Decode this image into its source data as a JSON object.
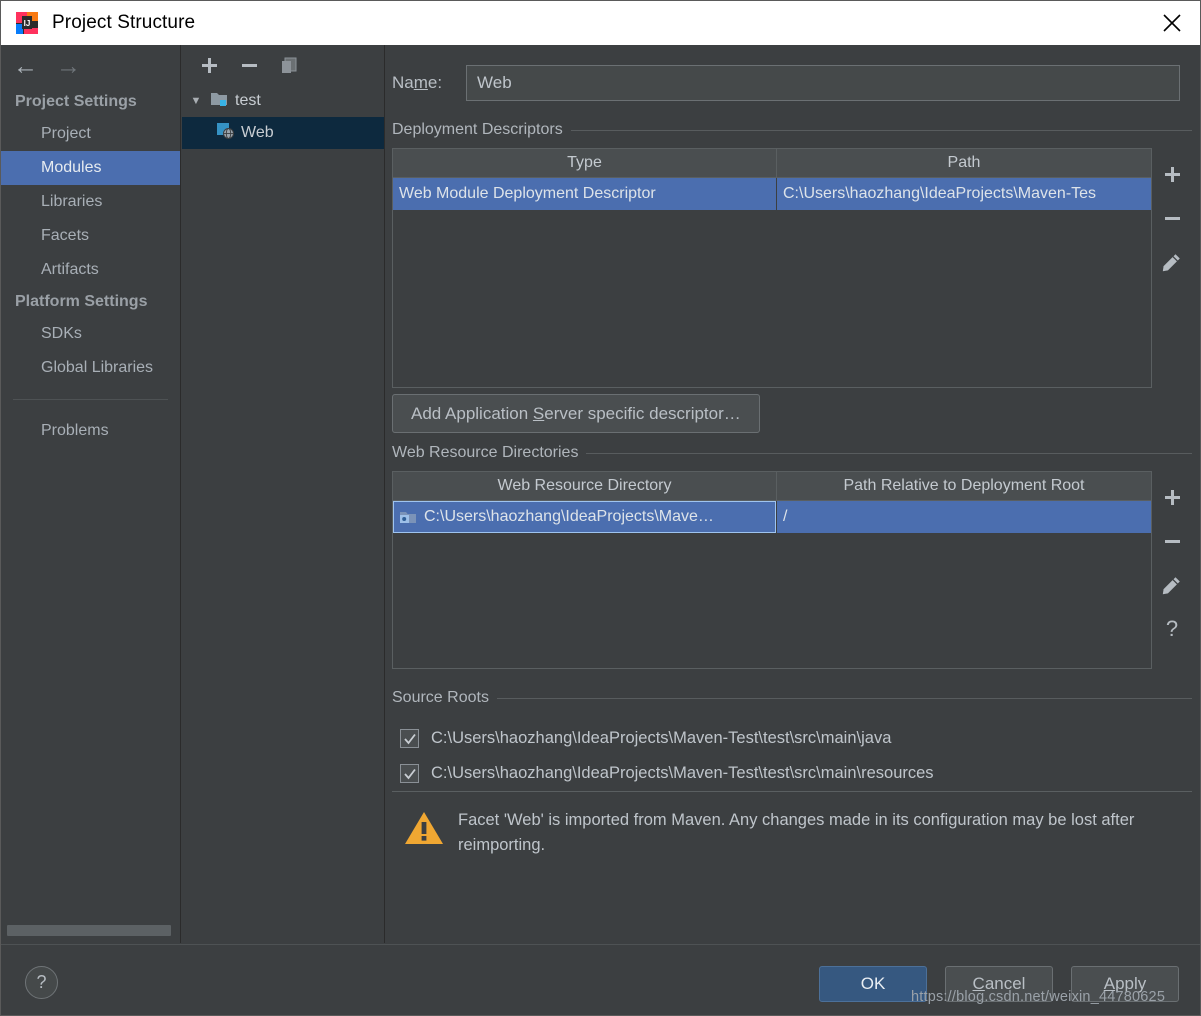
{
  "window": {
    "title": "Project Structure",
    "logo_icon": "intellij-idea-logo-icon",
    "close_icon": "close-icon"
  },
  "sidebar": {
    "back_icon": "arrow-left-icon",
    "forward_icon": "arrow-right-icon",
    "groups": [
      {
        "title": "Project Settings",
        "items": [
          {
            "label": "Project",
            "selected": false
          },
          {
            "label": "Modules",
            "selected": true
          },
          {
            "label": "Libraries",
            "selected": false
          },
          {
            "label": "Facets",
            "selected": false
          },
          {
            "label": "Artifacts",
            "selected": false
          }
        ]
      },
      {
        "title": "Platform Settings",
        "items": [
          {
            "label": "SDKs",
            "selected": false
          },
          {
            "label": "Global Libraries",
            "selected": false
          }
        ]
      }
    ],
    "extra_items": [
      {
        "label": "Problems",
        "selected": false
      }
    ],
    "selected_color": "#4b6eaf"
  },
  "tree_panel": {
    "toolbar": {
      "add_icon": "plus-icon",
      "remove_icon": "minus-icon",
      "copy_icon": "copy-icon"
    },
    "nodes": [
      {
        "label": "test",
        "icon": "module-folder-icon",
        "expanded": true,
        "selected": false,
        "toggle": "▼"
      },
      {
        "label": "Web",
        "icon": "web-facet-icon",
        "expanded": false,
        "selected": true,
        "toggle": ""
      }
    ]
  },
  "main": {
    "name": {
      "label_pre": "Na",
      "label_mnemonic": "m",
      "label_post": "e:",
      "value": "Web"
    },
    "deployment_descriptors": {
      "title": "Deployment Descriptors",
      "columns": [
        "Type",
        "Path"
      ],
      "rows": [
        {
          "type": "Web Module Deployment Descriptor",
          "path": "C:\\Users\\haozhang\\IdeaProjects\\Maven-Tes",
          "selected": true
        }
      ],
      "tools": [
        {
          "name": "add-descriptor-button",
          "icon": "plus-icon",
          "glyph": "+"
        },
        {
          "name": "remove-descriptor-button",
          "icon": "minus-icon",
          "glyph": "−"
        },
        {
          "name": "edit-descriptor-button",
          "icon": "pencil-icon",
          "glyph": "pencil"
        }
      ],
      "add_button": {
        "pre": "Add Application ",
        "mnemonic": "S",
        "post": "erver specific descriptor…"
      }
    },
    "web_resource_directories": {
      "title": "Web Resource Directories",
      "columns": [
        "Web Resource Directory",
        "Path Relative to Deployment Root"
      ],
      "rows": [
        {
          "directory": "C:\\Users\\haozhang\\IdeaProjects\\Mave…",
          "directory_icon": "folder-icon",
          "relative_path": "/",
          "selected": true
        }
      ],
      "tools": [
        {
          "name": "add-web-resource-button",
          "icon": "plus-icon",
          "glyph": "+"
        },
        {
          "name": "remove-web-resource-button",
          "icon": "minus-icon",
          "glyph": "−"
        },
        {
          "name": "edit-web-resource-button",
          "icon": "pencil-icon",
          "glyph": "pencil"
        },
        {
          "name": "web-resource-help-button",
          "icon": "question-mark-icon",
          "glyph": "?"
        }
      ]
    },
    "source_roots": {
      "title": "Source Roots",
      "items": [
        {
          "path": "C:\\Users\\haozhang\\IdeaProjects\\Maven-Test\\test\\src\\main\\java",
          "checked": true
        },
        {
          "path": "C:\\Users\\haozhang\\IdeaProjects\\Maven-Test\\test\\src\\main\\resources",
          "checked": true
        }
      ]
    },
    "warning": {
      "icon": "warning-triangle-icon",
      "text": "Facet 'Web' is imported from Maven. Any changes made in its configuration may be lost after reimporting.",
      "color": "#f0a732"
    }
  },
  "footer": {
    "help_label": "?",
    "help_icon": "question-mark-icon",
    "ok_label": "OK",
    "cancel": {
      "pre": "",
      "mnemonic": "C",
      "post": "ancel",
      "label": "Cancel"
    },
    "apply": {
      "pre": "",
      "mnemonic": "A",
      "post": "pply",
      "label": "Apply"
    },
    "ok_color": "#365880"
  },
  "watermark": {
    "text": "https://blog.csdn.net/weixin_44780625"
  }
}
